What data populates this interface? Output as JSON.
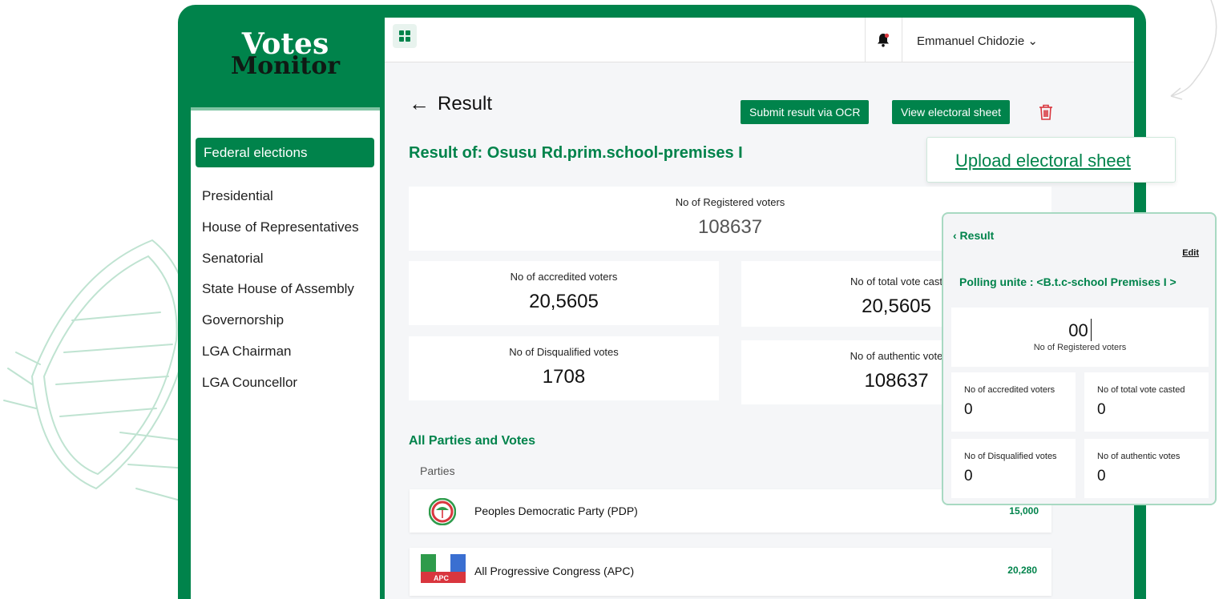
{
  "app": {
    "logo_line1": "Votes",
    "logo_line2": "Monitor"
  },
  "colors": {
    "brand_green": "#00834b",
    "danger_red": "#d9363e"
  },
  "sidebar": {
    "active_item": "Federal elections",
    "items": [
      {
        "label": "Presidential"
      },
      {
        "label": "House of Representatives"
      },
      {
        "label": "Senatorial"
      },
      {
        "label": "State House of Assembly"
      },
      {
        "label": "Governorship"
      },
      {
        "label": "LGA Chairman"
      },
      {
        "label": "LGA Councellor"
      }
    ]
  },
  "topbar": {
    "grid_icon": "grid-icon",
    "bell_icon": "bell-icon",
    "user_name": "Emmanuel Chidozie",
    "user_chevron": "⌄"
  },
  "page": {
    "back_arrow": "←",
    "title": "Result",
    "submit_ocr_label": "Submit result via OCR",
    "view_sheet_label": "View electoral sheet",
    "trash_icon": "trash-icon",
    "result_of": "Result of: Osusu Rd.prim.school-premises I"
  },
  "stats": {
    "registered": {
      "label": "No of Registered voters",
      "value": "108637"
    },
    "accredited": {
      "label": "No of accredited voters",
      "value": "20,5605"
    },
    "total_cast": {
      "label": "No of total vote cast",
      "value": "20,5605"
    },
    "disqualified": {
      "label": "No of Disqualified votes",
      "value": "1708"
    },
    "authentic": {
      "label": "No of authentic vote",
      "value": "108637"
    }
  },
  "parties": {
    "section_title": "All Parties and Votes",
    "column_header": "Parties",
    "rows": [
      {
        "name": "Peoples Democratic Party (PDP)",
        "votes": "15,000"
      },
      {
        "name": "All Progressive Congress (APC)",
        "votes": "20,280",
        "logo_text": "APC"
      }
    ]
  },
  "upload": {
    "link_label": "Upload electoral sheet"
  },
  "mobile": {
    "back_label": "‹  Result",
    "edit_label": "Edit",
    "polling_unit": "Polling unite : <B.t.c-school Premises I >",
    "registered": {
      "value": "00",
      "label": "No of Registered voters"
    },
    "accredited": {
      "label": "No of accredited voters",
      "value": "0"
    },
    "total_cast": {
      "label": "No of total vote casted",
      "value": "0"
    },
    "disqualified": {
      "label": "No of Disqualified votes",
      "value": "0"
    },
    "authentic": {
      "label": "No of authentic votes",
      "value": "0"
    }
  }
}
